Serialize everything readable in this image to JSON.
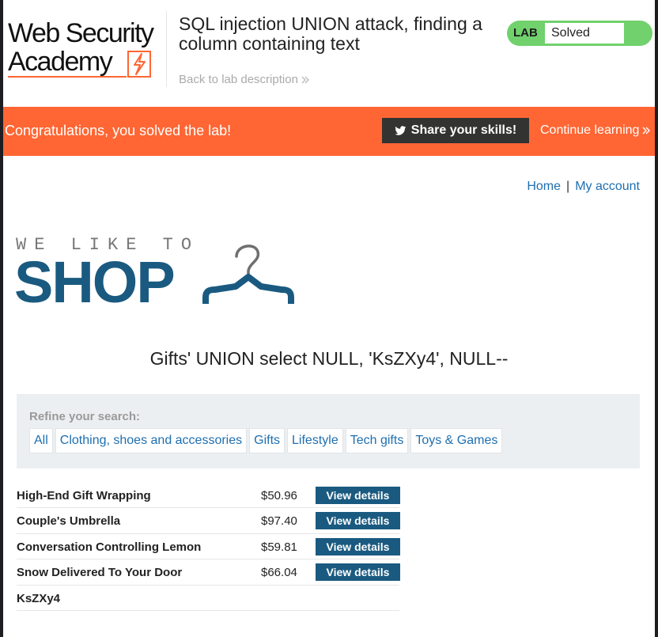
{
  "header": {
    "logo_line1": "Web Security",
    "logo_line2": "Academy",
    "lab_title": "SQL injection UNION attack, finding a column containing text",
    "back_link": "Back to lab description",
    "lab_tag": "LAB",
    "lab_status": "Solved"
  },
  "banner": {
    "message": "Congratulations, you solved the lab!",
    "share_label": "Share your skills!",
    "continue_label": "Continue learning"
  },
  "nav": {
    "home": "Home",
    "separator": "|",
    "account": "My account"
  },
  "shop_logo": {
    "tagline": "WE LIKE TO",
    "word": "SHOP"
  },
  "search_title": "Gifts' UNION select NULL, 'KsZXy4', NULL--",
  "filters": {
    "label": "Refine your search:",
    "categories": [
      "All",
      "Clothing, shoes and accessories",
      "Gifts",
      "Lifestyle",
      "Tech gifts",
      "Toys & Games"
    ]
  },
  "products": [
    {
      "name": "High-End Gift Wrapping",
      "price": "$50.96",
      "button": "View details"
    },
    {
      "name": "Couple's Umbrella",
      "price": "$97.40",
      "button": "View details"
    },
    {
      "name": "Conversation Controlling Lemon",
      "price": "$59.81",
      "button": "View details"
    },
    {
      "name": "Snow Delivered To Your Door",
      "price": "$66.04",
      "button": "View details"
    },
    {
      "name": "KsZXy4",
      "price": "",
      "button": ""
    }
  ],
  "colors": {
    "accent_orange": "#ff6633",
    "solved_green": "#70d16d",
    "shop_blue": "#1a5a80",
    "link_blue": "#1e6fb0"
  }
}
